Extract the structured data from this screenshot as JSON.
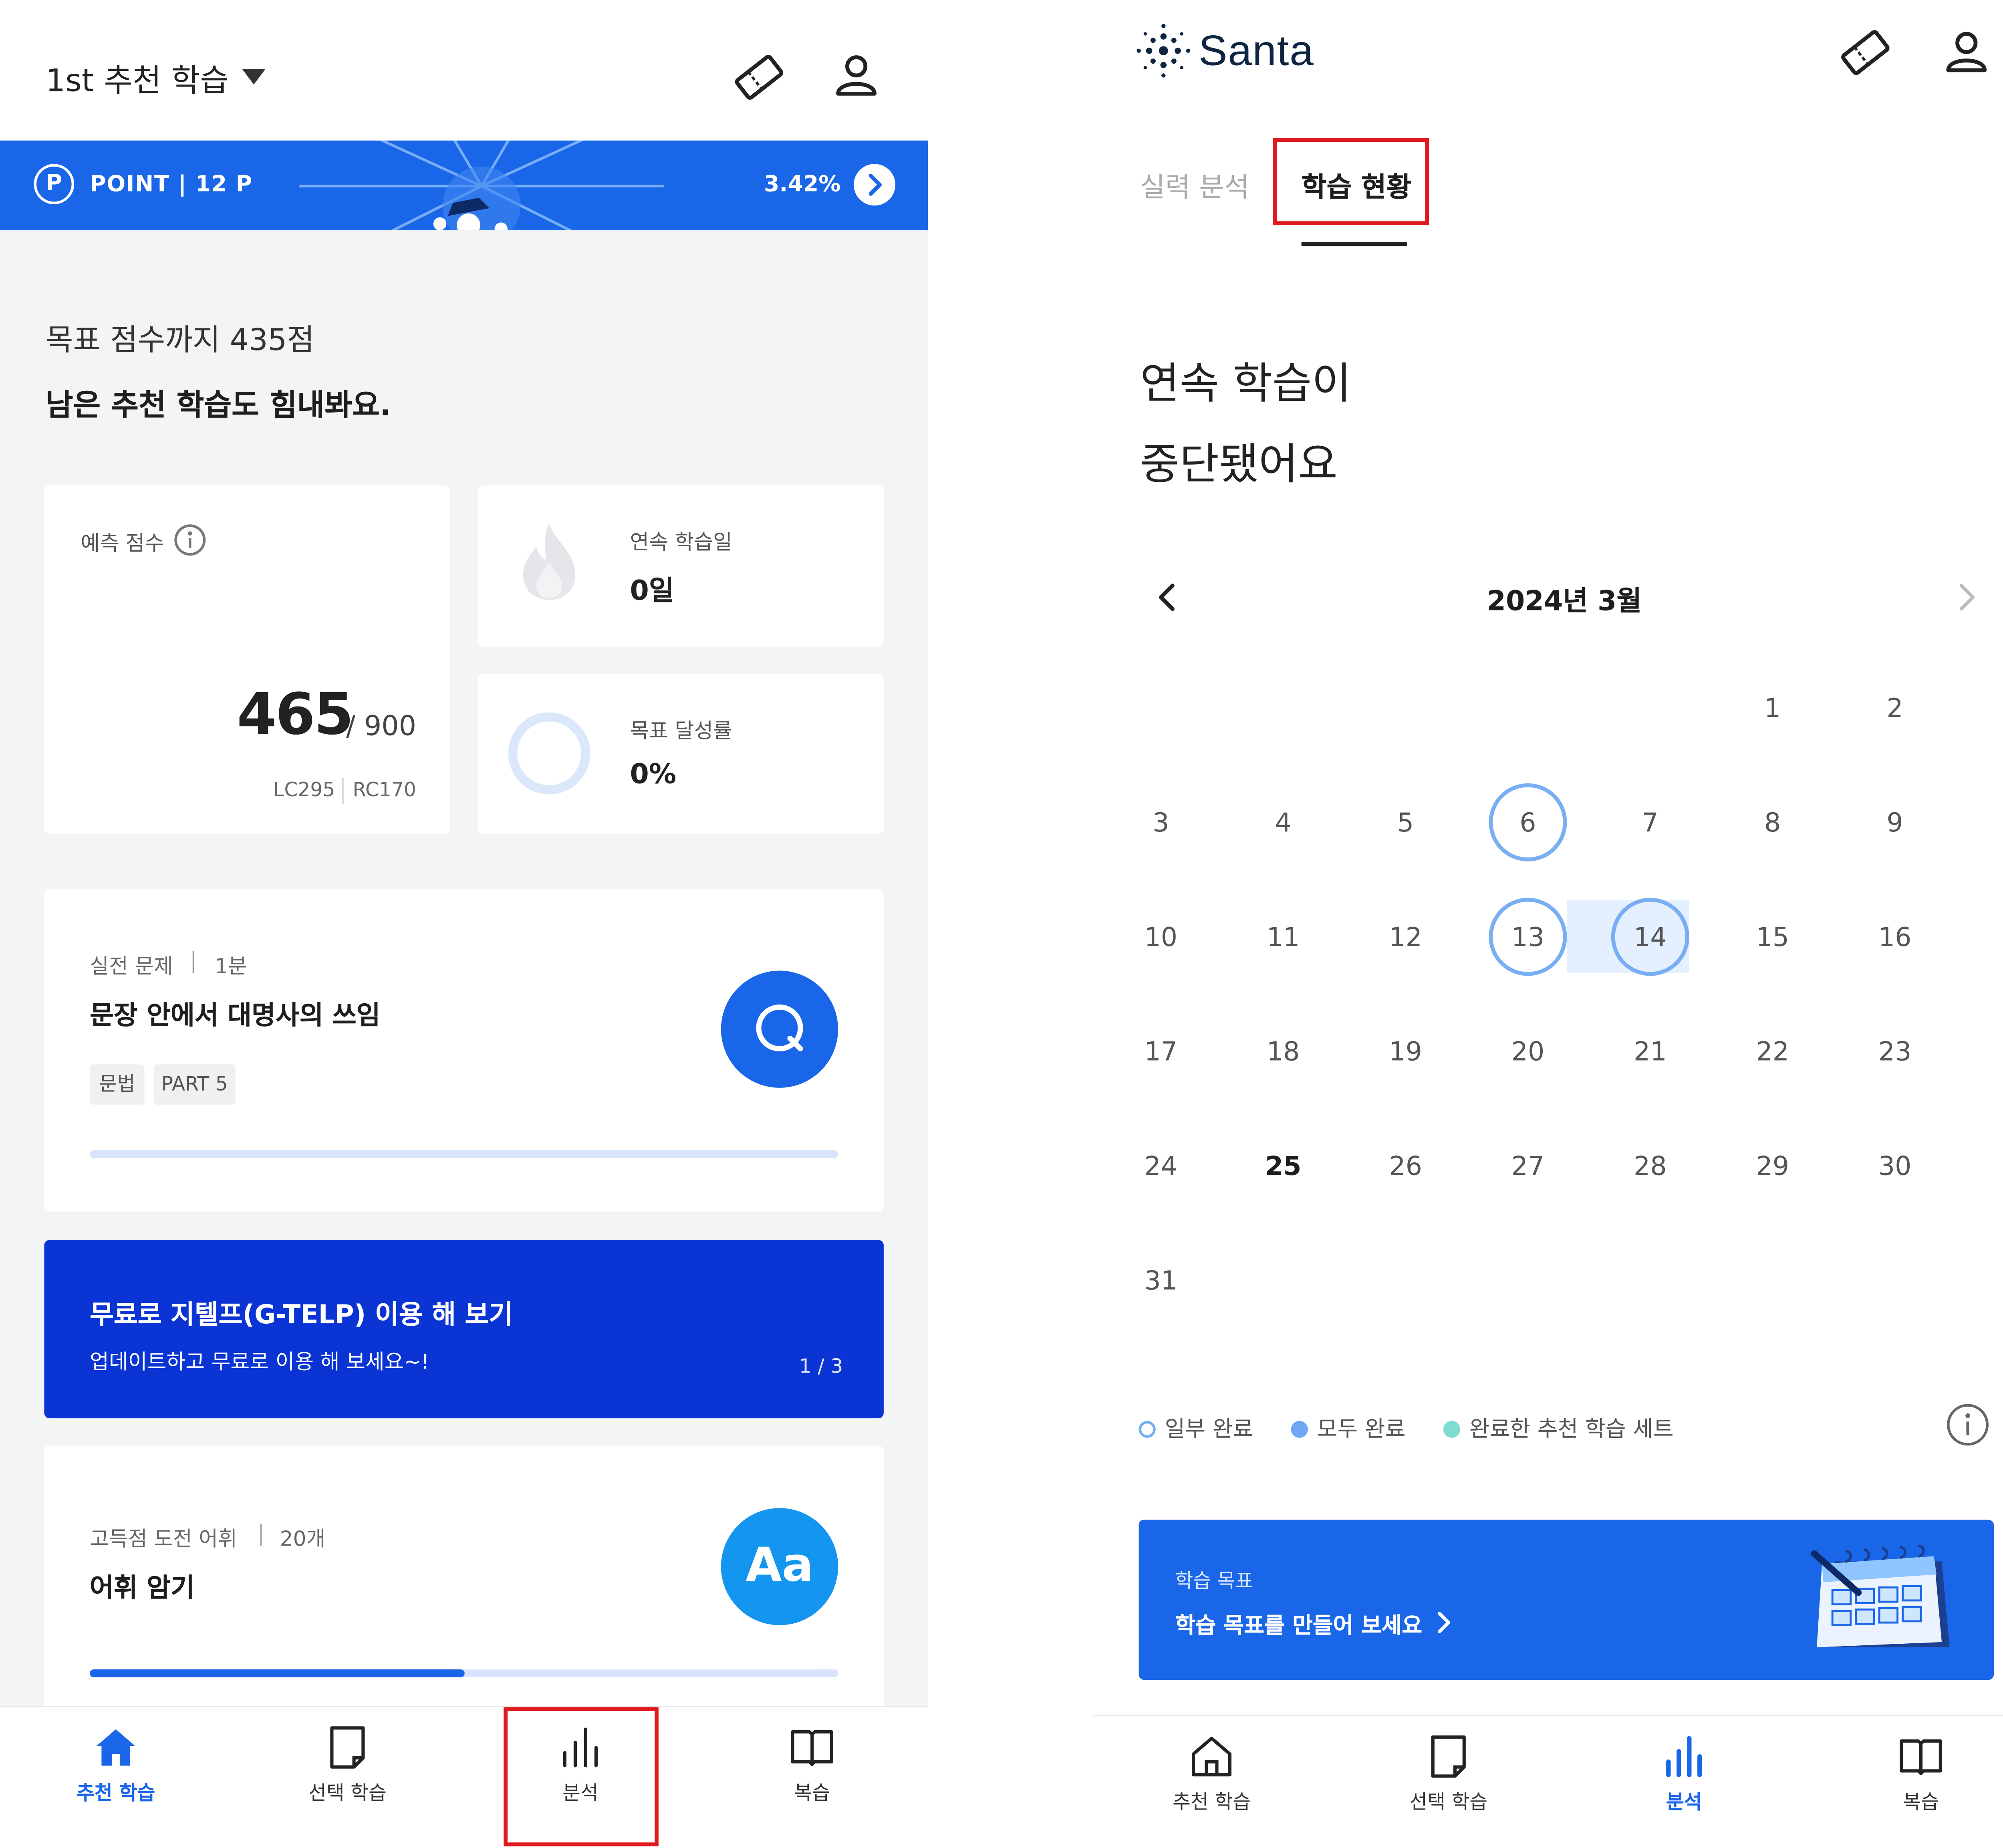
{
  "left": {
    "header_title": "1st 추천 학습",
    "point": {
      "icon_letter": "P",
      "label": "POINT | 12 P",
      "percent": "3.42%"
    },
    "goal_line1": "목표 점수까지 435점",
    "goal_line2": "남은 추천 학습도 힘내봐요.",
    "score_card": {
      "label": "예측 점수",
      "score": "465",
      "max": "/ 900",
      "lc": "LC295",
      "rc": "RC170"
    },
    "streak": {
      "label": "연속 학습일",
      "value": "0일"
    },
    "achieve": {
      "label": "목표 달성률",
      "value": "0%",
      "progress": 0
    },
    "study1": {
      "category": "실전 문제",
      "duration": "1분",
      "title": "문장 안에서 대명사의 쓰임",
      "tags": [
        "문법",
        "PART 5"
      ],
      "progress": 0
    },
    "banner": {
      "title": "무료로 지텔프(G-TELP) 이용 해 보기",
      "subtitle": "업데이트하고 무료로 이용 해 보세요~!",
      "pager": "1 / 3"
    },
    "study2": {
      "category": "고득점 도전 어휘",
      "count": "20개",
      "title": "어휘 암기",
      "icon_text": "Aa",
      "progress": 0.5
    },
    "nav": [
      "추천 학습",
      "선택 학습",
      "분석",
      "복습"
    ],
    "nav_active": 0,
    "nav_highlight": 2
  },
  "right": {
    "brand": "Santa",
    "tabs": [
      "실력 분석",
      "학습 현황"
    ],
    "active_tab": 1,
    "headline": [
      "연속 학습이",
      "중단됐어요"
    ],
    "month": "2024년 3월",
    "days": [
      "1",
      "2",
      "3",
      "4",
      "5",
      "6",
      "7",
      "8",
      "9",
      "10",
      "11",
      "12",
      "13",
      "14",
      "15",
      "16",
      "17",
      "18",
      "19",
      "20",
      "21",
      "22",
      "23",
      "24",
      "25",
      "26",
      "27",
      "28",
      "29",
      "30",
      "31"
    ],
    "ringed_days": [
      "6",
      "13",
      "14"
    ],
    "today": "25",
    "legend": [
      {
        "label": "일부 완료",
        "color": "#78aef2"
      },
      {
        "label": "모두 완료",
        "color": "#6fa6f5"
      },
      {
        "label": "완료한 추천 학습 세트",
        "color": "#7fdcd2"
      }
    ],
    "goal_card": {
      "small": "학습 목표",
      "main": "학습 목표를 만들어 보세요"
    },
    "nav": [
      "추천 학습",
      "선택 학습",
      "분석",
      "복습"
    ],
    "nav_active": 2
  },
  "colors": {
    "accent": "#1a66e8",
    "banner": "#0a34d4",
    "highlight": "#e0191e"
  }
}
